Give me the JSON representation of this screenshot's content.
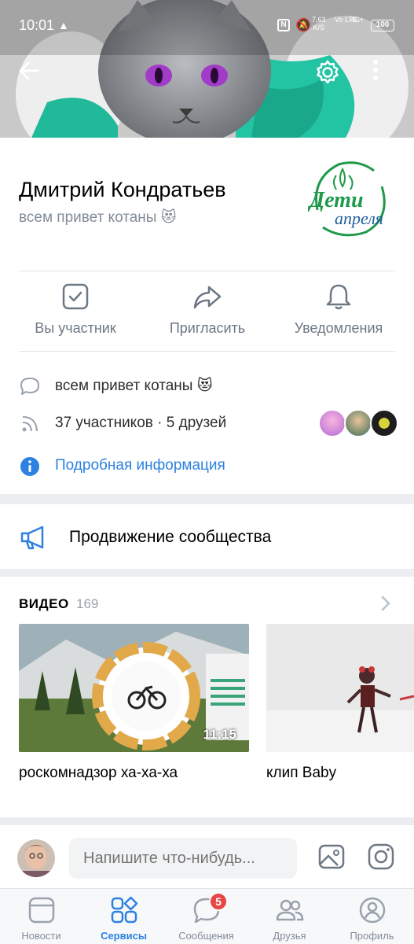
{
  "status_bar": {
    "time": "10:01",
    "net_speed_value": "7,63",
    "net_speed_unit": "K/S",
    "volte": "Vo LTE",
    "signal": "4G+",
    "battery": "100"
  },
  "group": {
    "name": "Дмитрий Кондратьев",
    "status": "всем привет котаны 😻",
    "logo_text_1": "Дети",
    "logo_text_2": "апреля"
  },
  "actions": [
    {
      "label": "Вы участник"
    },
    {
      "label": "Пригласить"
    },
    {
      "label": "Уведомления"
    }
  ],
  "info": {
    "status_line": "всем привет котаны 😻",
    "members_line": "37 участников · 5 друзей",
    "details_link": "Подробная информация"
  },
  "promo": {
    "label": "Продвижение сообщества"
  },
  "videos": {
    "title": "ВИДЕО",
    "count": "169",
    "items": [
      {
        "title": "роскомнадзор ха-ха-ха",
        "duration": "11:15"
      },
      {
        "title": "клип Baby",
        "duration": ""
      }
    ]
  },
  "composer": {
    "placeholder": "Напишите что-нибудь..."
  },
  "tabbar": {
    "items": [
      {
        "label": "Новости"
      },
      {
        "label": "Сервисы"
      },
      {
        "label": "Сообщения",
        "badge": "5"
      },
      {
        "label": "Друзья"
      },
      {
        "label": "Профиль"
      }
    ],
    "active_index": 1
  },
  "colors": {
    "accent": "#2d81e0",
    "secondary_text": "#818c99",
    "badge": "#e64646",
    "logo_green": "#1f9a4a"
  }
}
